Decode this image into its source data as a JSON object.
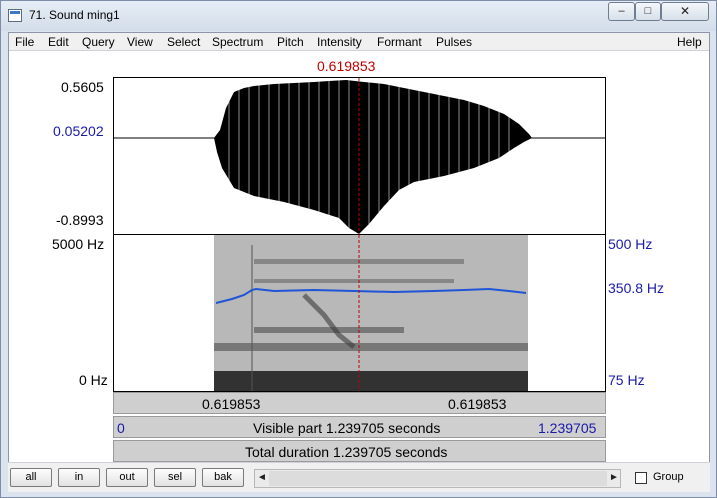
{
  "window": {
    "title": "71. Sound ming1",
    "minimize_glyph": "–",
    "maximize_glyph": "□",
    "close_glyph": "✕"
  },
  "menubar": {
    "items": [
      "File",
      "Edit",
      "Query",
      "View",
      "Select",
      "Spectrum",
      "Pitch",
      "Intensity",
      "Formant",
      "Pulses"
    ],
    "help": "Help"
  },
  "editor": {
    "cursor_time_top": "0.619853",
    "waveform": {
      "max_label": "0.5605",
      "zero_label": "0.05202",
      "min_label": "-0.8993"
    },
    "spectrogram": {
      "freq_top_label": "5000 Hz",
      "freq_bottom_label": "0 Hz",
      "pitch_top_label": "500 Hz",
      "pitch_value_label": "350.8 Hz",
      "pitch_bottom_label": "75 Hz"
    },
    "time_bar": {
      "left_segment": "0.619853",
      "right_segment": "0.619853"
    },
    "visible_bar": {
      "start": "0",
      "label": "Visible part 1.239705 seconds",
      "end": "1.239705"
    },
    "total_bar": {
      "label": "Total duration 1.239705 seconds"
    }
  },
  "bottom": {
    "buttons": [
      "all",
      "in",
      "out",
      "sel",
      "bak"
    ],
    "scroll_left_glyph": "◄",
    "scroll_right_glyph": "►",
    "group_label": "Group"
  },
  "colors": {
    "cursor_red": "#c00000",
    "label_blue": "#1a1aa8",
    "pitch_curve_blue": "#1f55d6",
    "waveform_black": "#000000"
  }
}
